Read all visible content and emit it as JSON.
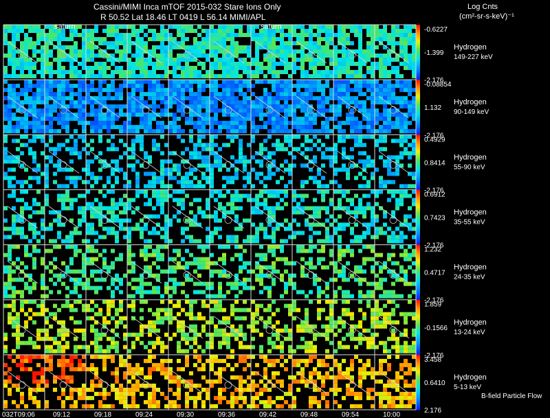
{
  "header": {
    "title": "Cassini/MIMI Inca mTOF  2015-032   Stare   Ions Only",
    "info": "R         50.52 Lat 18.46 LT 0419 L          56.14  MIMI/APL",
    "units_line1": "Log Cnts",
    "units_line2": "(cm²-sr-s-keV)⁻¹",
    "saturn_label": "saturn",
    "footnote": "B-field Particle Flow"
  },
  "chart_data": {
    "type": "heatmap",
    "instrument": "Cassini/MIMI INCA mTOF",
    "date": "2015-032",
    "mode": "Stare",
    "species_filter": "Ions Only",
    "ephemeris": {
      "R": 50.52,
      "Lat": 18.46,
      "LT": "0419",
      "L": 56.14
    },
    "time_labels": [
      "032T09:06",
      "09:12",
      "09:18",
      "09:24",
      "09:30",
      "09:36",
      "09:42",
      "09:48",
      "09:54",
      "10:00"
    ],
    "grid": true,
    "colorbar": "rainbow",
    "saturn_marker_columns": [
      1,
      6
    ],
    "panels": [
      {
        "species": "Hydrogen",
        "energy": "149-227 keV",
        "cmax": "-0.6227",
        "cmid": "-1.399",
        "cmin": "-2.176",
        "level": 0.42
      },
      {
        "species": "Hydrogen",
        "energy": "90-149 keV",
        "cmax": "-0.08854",
        "cmid": "1.132",
        "cmin": "-2.176",
        "level": 0.2
      },
      {
        "species": "Hydrogen",
        "energy": "55-90 keV",
        "cmax": "0.4929",
        "cmid": "0.8414",
        "cmin": "-2.176",
        "level": 0.33
      },
      {
        "species": "Hydrogen",
        "energy": "35-55 keV",
        "cmax": "0.6912",
        "cmid": "0.7423",
        "cmin": "-2.176",
        "level": 0.4
      },
      {
        "species": "Hydrogen",
        "energy": "24-35 keV",
        "cmax": "1.232",
        "cmid": "0.4717",
        "cmin": "-2.176",
        "level": 0.5
      },
      {
        "species": "Hydrogen",
        "energy": "13-24 keV",
        "cmax": "1.859",
        "cmid": "-0.1566",
        "cmin": "-2.176",
        "level": 0.62
      },
      {
        "species": "Hydrogen",
        "energy": "5-13 keV",
        "cmax": "3.458",
        "cmid": "0.6410",
        "cmin": "2.176",
        "level": 0.78
      }
    ]
  }
}
